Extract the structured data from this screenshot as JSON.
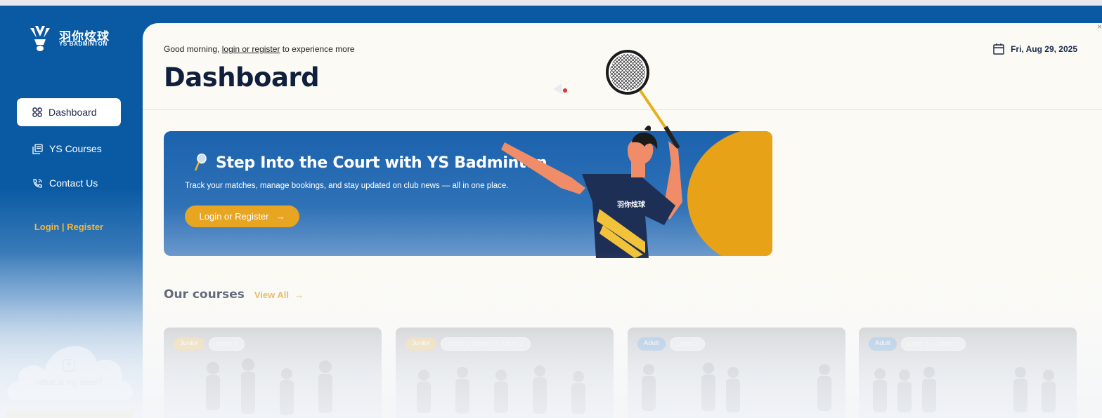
{
  "brand": {
    "name_cn": "羽你炫球",
    "name_en": "YS BADMINTON"
  },
  "sidebar": {
    "items": [
      {
        "label": "Dashboard",
        "icon": "dashboard-grid-icon",
        "active": true
      },
      {
        "label": "YS Courses",
        "icon": "courses-icon",
        "active": false
      },
      {
        "label": "Contact Us",
        "icon": "phone-icon",
        "active": false
      }
    ],
    "login_register": "Login | Register",
    "level_prompt": "What is my level?"
  },
  "header": {
    "greeting_prefix": "Good morning,",
    "greeting_link": "login or register",
    "greeting_suffix": "to experience more",
    "title": "Dashboard",
    "date": "Fri, Aug 29, 2025"
  },
  "hero": {
    "title": "Step Into the Court with YS Badminton",
    "subtitle": "Track your matches, manage bookings, and stay updated on club news — all in one place.",
    "button_label": "Login or Register",
    "shirt_text": "羽你炫球"
  },
  "courses": {
    "title": "Our courses",
    "view_all": "View All",
    "cards": [
      {
        "category": "Junior",
        "levels": "Level 3"
      },
      {
        "category": "Junior",
        "levels": "Level 1, Level 1+, Level 2"
      },
      {
        "category": "Adult",
        "levels": "Level 3"
      },
      {
        "category": "Adult",
        "levels": "Level 1+, Level 2"
      }
    ]
  },
  "colors": {
    "primary_blue": "#0a5aa3",
    "accent_gold": "#e7a521",
    "panel_bg": "#fcfaf4",
    "title_navy": "#0f1f3d"
  }
}
